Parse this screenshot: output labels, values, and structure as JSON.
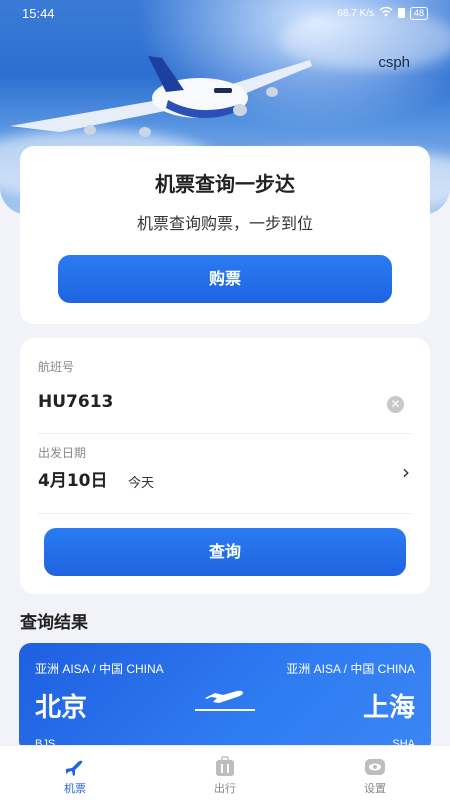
{
  "status_bar": {
    "time": "15:44",
    "network_speed": "68.7 K/s",
    "battery": "48"
  },
  "header": {
    "brand": "csph"
  },
  "promo": {
    "title": "机票查询一步达",
    "subtitle": "机票查询购票，一步到位",
    "buy_button": "购票"
  },
  "search": {
    "flight_label": "航班号",
    "flight_value": "HU7613",
    "date_label": "出发日期",
    "date_value": "4月10日",
    "date_hint": "今天",
    "query_button": "查询"
  },
  "results": {
    "title": "查询结果",
    "items": [
      {
        "origin_region": "亚洲 AISA / 中国 CHINA",
        "origin_city": "北京",
        "origin_code": "BJS",
        "dest_region": "亚洲 AISA / 中国 CHINA",
        "dest_city": "上海",
        "dest_code": "SHA"
      }
    ]
  },
  "tabs": [
    {
      "label": "机票",
      "icon": "airplane-icon",
      "active": true
    },
    {
      "label": "出行",
      "icon": "luggage-icon",
      "active": false
    },
    {
      "label": "设置",
      "icon": "eye-icon",
      "active": false
    }
  ],
  "colors": {
    "primary": "#1f63e0",
    "accent_gradient_end": "#3b86f5",
    "background": "#f2f3f8"
  }
}
